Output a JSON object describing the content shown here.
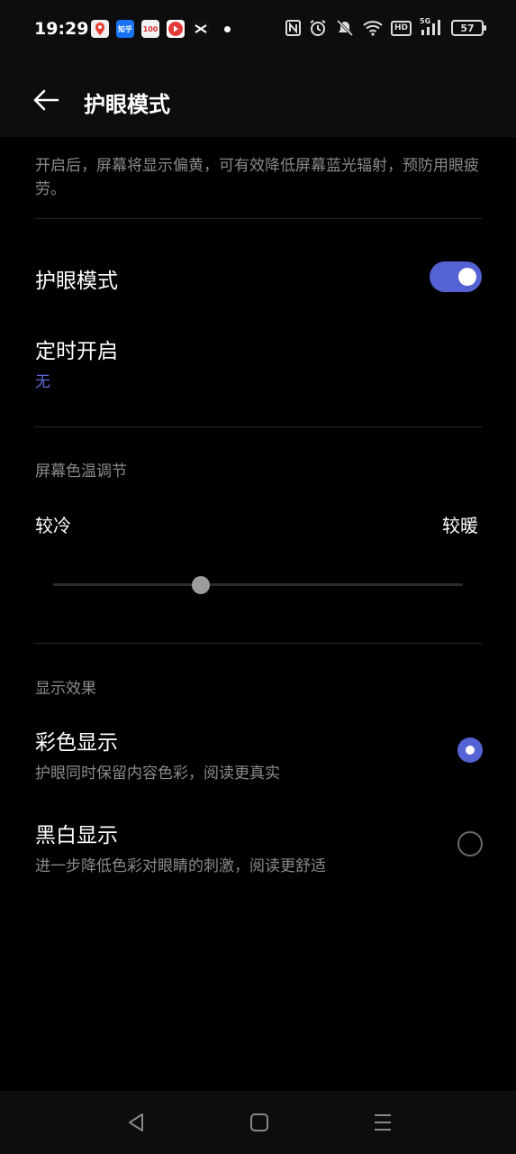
{
  "status_bar": {
    "time": "19:29",
    "app_icons": [
      {
        "name": "map-app-icon",
        "color": "#e8e8e8"
      },
      {
        "name": "zhihu-app-icon",
        "text": "知乎",
        "color": "#1772f6"
      },
      {
        "name": "calendar-100-app-icon",
        "text": "100",
        "color": "#f0f0f0"
      },
      {
        "name": "video-app-icon",
        "color": "#e33"
      },
      {
        "name": "capcut-app-icon",
        "color": "#111"
      }
    ],
    "battery": "57",
    "network": "5G",
    "hd_badge": "HD"
  },
  "header": {
    "title": "护眼模式"
  },
  "description": "开启后，屏幕将显示偏黄，可有效降低屏幕蓝光辐射，预防用眼疲劳。",
  "eye_mode": {
    "label": "护眼模式",
    "enabled": true
  },
  "schedule": {
    "label": "定时开启",
    "value": "无"
  },
  "color_temp": {
    "section": "屏幕色温调节",
    "cold_label": "较冷",
    "warm_label": "较暖",
    "level": 0.36
  },
  "display_effect": {
    "section": "显示效果",
    "options": [
      {
        "title": "彩色显示",
        "subtitle": "护眼同时保留内容色彩，阅读更真实",
        "selected": true
      },
      {
        "title": "黑白显示",
        "subtitle": "进一步降低色彩对眼睛的刺激，阅读更舒适",
        "selected": false
      }
    ]
  },
  "colors": {
    "accent": "#5562d3",
    "background": "#000000",
    "secondary_text": "#8a8a8a"
  }
}
